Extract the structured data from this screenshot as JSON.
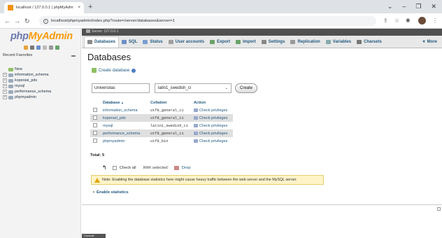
{
  "browser": {
    "tab_title": "localhost / 127.0.0.1 | phpMyAdm",
    "tab_close": "×",
    "new_tab": "+",
    "win_min": "–",
    "win_restore": "❐",
    "win_close": "✕",
    "url": "localhost/phpmyadmin/index.php?route=/server/databases&server=1"
  },
  "sidebar": {
    "logo_php": "php",
    "logo_myadmin": "MyAdmin",
    "recent_favorites": "Recent  Favorites",
    "tree": [
      {
        "label": "New",
        "expander": ""
      },
      {
        "label": "information_schema",
        "expander": "+"
      },
      {
        "label": "koperasi_pds",
        "expander": "+"
      },
      {
        "label": "mysql",
        "expander": "+"
      },
      {
        "label": "performance_schema",
        "expander": "+"
      },
      {
        "label": "phpmyadmin",
        "expander": "+"
      }
    ]
  },
  "header": {
    "server_crumb": "Server: 127.0.0.1"
  },
  "tabs": [
    {
      "label": "Databases",
      "color": "#8a8a8a"
    },
    {
      "label": "SQL",
      "color": "#6a8fc8"
    },
    {
      "label": "Status",
      "color": "#7a9fd0"
    },
    {
      "label": "User accounts",
      "color": "#a0a0a0"
    },
    {
      "label": "Export",
      "color": "#6aa36a"
    },
    {
      "label": "Import",
      "color": "#6aa36a"
    },
    {
      "label": "Settings",
      "color": "#888"
    },
    {
      "label": "Replication",
      "color": "#999"
    },
    {
      "label": "Variables",
      "color": "#8aa"
    },
    {
      "label": "Charsets",
      "color": "#777"
    },
    {
      "label": "More",
      "color": "#777"
    }
  ],
  "main": {
    "title": "Databases",
    "create_heading": "Create database",
    "db_name_value": "Universitas",
    "collation_value": "latin1_swedish_ci",
    "create_label": "Create",
    "columns": {
      "database": "Database",
      "sort": "▲",
      "collation": "Collation",
      "action": "Action"
    },
    "rows": [
      {
        "name": "information_schema",
        "collation": "utf8_general_ci",
        "action": "Check privileges"
      },
      {
        "name": "koperasi_pds",
        "collation": "utf8_general_ci",
        "action": "Check privileges"
      },
      {
        "name": "mysql",
        "collation": "latin1_swedish_ci",
        "action": "Check privileges"
      },
      {
        "name": "performance_schema",
        "collation": "utf8_general_ci",
        "action": "Check privileges"
      },
      {
        "name": "phpmyadmin",
        "collation": "utf8_bin",
        "action": "Check privileges"
      }
    ],
    "total": "Total: 5",
    "check_all": "Check all",
    "with_selected": "With selected:",
    "drop": "Drop",
    "notice": "Note: Enabling the database statistics here might cause heavy traffic between the web server and the MySQL server.",
    "enable_stats": "Enable statistics",
    "console": "Console"
  }
}
